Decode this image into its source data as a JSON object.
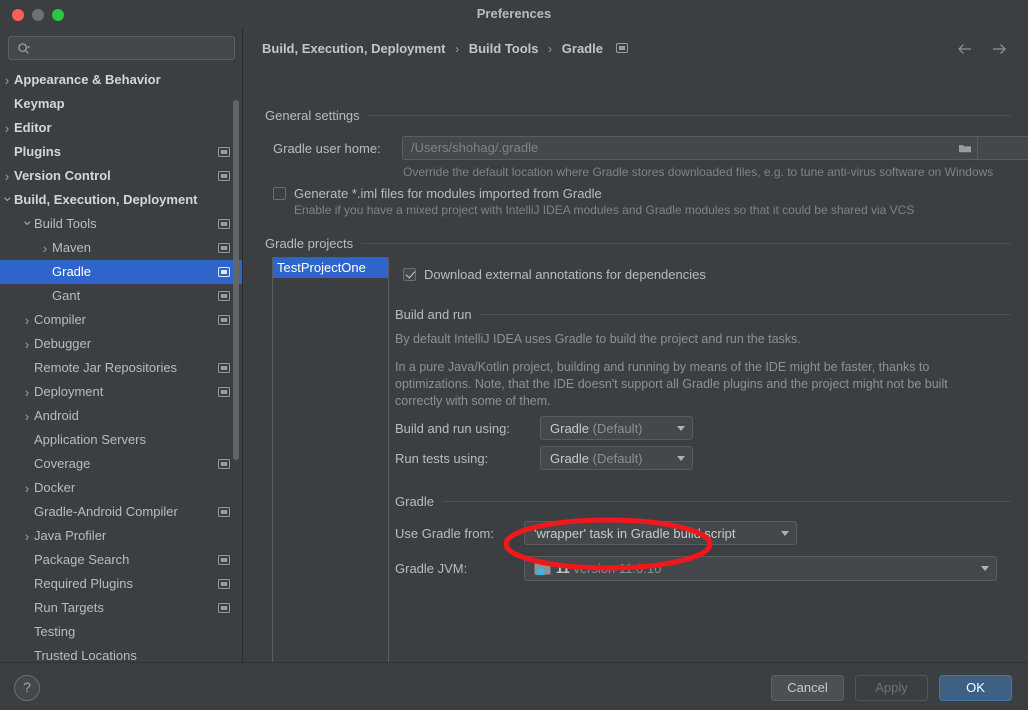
{
  "window": {
    "title": "Preferences",
    "traffic_lights": [
      "close-red",
      "minimize-gray",
      "zoom-green"
    ]
  },
  "sidebar": {
    "search_placeholder": "",
    "search_icon": "search-icon",
    "items": [
      {
        "label": "Appearance & Behavior",
        "depth": 0,
        "arrow": "collapsed",
        "bold": true,
        "badge": false
      },
      {
        "label": "Keymap",
        "depth": 0,
        "arrow": "none",
        "bold": true,
        "badge": false
      },
      {
        "label": "Editor",
        "depth": 0,
        "arrow": "collapsed",
        "bold": true,
        "badge": false
      },
      {
        "label": "Plugins",
        "depth": 0,
        "arrow": "none",
        "bold": true,
        "badge": true
      },
      {
        "label": "Version Control",
        "depth": 0,
        "arrow": "collapsed",
        "bold": true,
        "badge": true
      },
      {
        "label": "Build, Execution, Deployment",
        "depth": 0,
        "arrow": "expanded",
        "bold": true,
        "badge": false
      },
      {
        "label": "Build Tools",
        "depth": 1,
        "arrow": "expanded",
        "bold": false,
        "badge": true
      },
      {
        "label": "Maven",
        "depth": 2,
        "arrow": "collapsed",
        "bold": false,
        "badge": true
      },
      {
        "label": "Gradle",
        "depth": 2,
        "arrow": "none",
        "bold": false,
        "badge": true,
        "selected": true
      },
      {
        "label": "Gant",
        "depth": 2,
        "arrow": "none",
        "bold": false,
        "badge": true
      },
      {
        "label": "Compiler",
        "depth": 1,
        "arrow": "collapsed",
        "bold": false,
        "badge": true
      },
      {
        "label": "Debugger",
        "depth": 1,
        "arrow": "collapsed",
        "bold": false,
        "badge": false
      },
      {
        "label": "Remote Jar Repositories",
        "depth": 1,
        "arrow": "none",
        "bold": false,
        "badge": true
      },
      {
        "label": "Deployment",
        "depth": 1,
        "arrow": "collapsed",
        "bold": false,
        "badge": true
      },
      {
        "label": "Android",
        "depth": 1,
        "arrow": "collapsed",
        "bold": false,
        "badge": false
      },
      {
        "label": "Application Servers",
        "depth": 1,
        "arrow": "none",
        "bold": false,
        "badge": false
      },
      {
        "label": "Coverage",
        "depth": 1,
        "arrow": "none",
        "bold": false,
        "badge": true
      },
      {
        "label": "Docker",
        "depth": 1,
        "arrow": "collapsed",
        "bold": false,
        "badge": false
      },
      {
        "label": "Gradle-Android Compiler",
        "depth": 1,
        "arrow": "none",
        "bold": false,
        "badge": true
      },
      {
        "label": "Java Profiler",
        "depth": 1,
        "arrow": "collapsed",
        "bold": false,
        "badge": false
      },
      {
        "label": "Package Search",
        "depth": 1,
        "arrow": "none",
        "bold": false,
        "badge": true
      },
      {
        "label": "Required Plugins",
        "depth": 1,
        "arrow": "none",
        "bold": false,
        "badge": true
      },
      {
        "label": "Run Targets",
        "depth": 1,
        "arrow": "none",
        "bold": false,
        "badge": true
      },
      {
        "label": "Testing",
        "depth": 1,
        "arrow": "none",
        "bold": false,
        "badge": false
      },
      {
        "label": "Trusted Locations",
        "depth": 1,
        "arrow": "none",
        "bold": false,
        "badge": false
      }
    ]
  },
  "header": {
    "breadcrumb": [
      "Build, Execution, Deployment",
      "Build Tools",
      "Gradle"
    ],
    "separator": "›",
    "badge_icon": "scope-badge-icon",
    "back_icon": "arrow-left-icon",
    "forward_icon": "arrow-right-icon"
  },
  "general_settings": {
    "group_title": "General settings",
    "user_home_label": "Gradle user home:",
    "user_home_placeholder": "/Users/shohag/.gradle",
    "user_home_value": "",
    "browse_icon": "folder-icon",
    "user_home_hint": "Override the default location where Gradle stores downloaded files, e.g. to tune anti-virus software on Windows",
    "generate_iml_label": "Generate *.iml files for modules imported from Gradle",
    "generate_iml_checked": false,
    "generate_iml_hint": "Enable if you have a mixed project with IntelliJ IDEA modules and Gradle modules so that it could be shared via VCS"
  },
  "gradle_projects": {
    "group_title": "Gradle projects",
    "projects": [
      {
        "label": "TestProjectOne",
        "selected": true
      }
    ],
    "download_annotations_label": "Download external annotations for dependencies",
    "download_annotations_checked": true
  },
  "build_and_run": {
    "group_title": "Build and run",
    "paragraph_1": "By default IntelliJ IDEA uses Gradle to build the project and run the tasks.",
    "paragraph_2": "In a pure Java/Kotlin project, building and running by means of the IDE might be faster, thanks to optimizations. Note, that the IDE doesn't support all Gradle plugins and the project might not be built correctly with some of them.",
    "build_run_using_label": "Build and run using:",
    "build_run_using_value": "Gradle",
    "build_run_using_suffix": "(Default)",
    "run_tests_using_label": "Run tests using:",
    "run_tests_using_value": "Gradle",
    "run_tests_using_suffix": "(Default)"
  },
  "gradle_section": {
    "group_title": "Gradle",
    "use_gradle_from_label": "Use Gradle from:",
    "use_gradle_from_value": "'wrapper' task in Gradle build script",
    "gradle_jvm_label": "Gradle JVM:",
    "gradle_jvm_icon": "java-folder-icon",
    "gradle_jvm_value": "11",
    "gradle_jvm_version": "version 11.0.10"
  },
  "annotation": {
    "shape": "ellipse",
    "color": "#f0181c",
    "target": "gradle-jvm-combo"
  },
  "footer": {
    "help_label": "?",
    "cancel_label": "Cancel",
    "apply_label": "Apply",
    "apply_enabled": false,
    "ok_label": "OK"
  },
  "colors": {
    "window_bg": "#3c3f41",
    "selection_blue": "#2f65ca",
    "default_button": "#3d6185",
    "annotation_red": "#f0181c"
  }
}
